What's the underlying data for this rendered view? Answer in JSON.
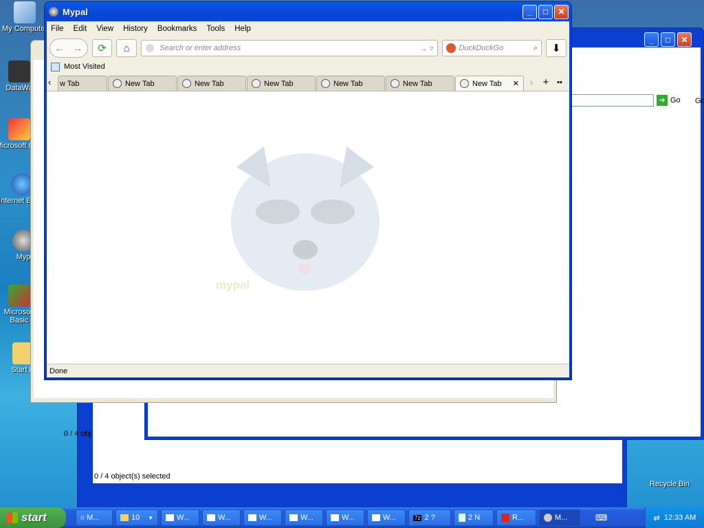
{
  "desktop": {
    "icons": [
      {
        "label": "My Computer"
      },
      {
        "label": "DataWa"
      },
      {
        "label": "Microsoft C++"
      },
      {
        "label": "Internet Explo"
      },
      {
        "label": "Myp"
      },
      {
        "label": "Microsoft Basic"
      },
      {
        "label": "Start M"
      },
      {
        "label": "Recycle Bin"
      }
    ]
  },
  "bg_windows": {
    "explorer_status_1": "0 / 4 obj",
    "explorer_status_2": "0 / 4 object(s) selected",
    "go_label": "Go",
    "go_label_2": "Go"
  },
  "window": {
    "title": "Mypal",
    "menu": [
      "File",
      "Edit",
      "View",
      "History",
      "Bookmarks",
      "Tools",
      "Help"
    ],
    "address_placeholder": "Search or enter address",
    "search_placeholder": "DuckDuckGo",
    "bookmarks_item": "Most Visited",
    "tabs": [
      {
        "label": "New Tab"
      },
      {
        "label": "New Tab"
      },
      {
        "label": "New Tab"
      },
      {
        "label": "New Tab"
      },
      {
        "label": "New Tab"
      },
      {
        "label": "New Tab"
      },
      {
        "label": "New Tab"
      }
    ],
    "first_tab_visible_text": "w Tab",
    "logo_text": "mypal",
    "status": "Done"
  },
  "taskbar": {
    "start_label": "start",
    "items": [
      {
        "label": "M..."
      },
      {
        "label": "10"
      },
      {
        "label": "W..."
      },
      {
        "label": "W..."
      },
      {
        "label": "W..."
      },
      {
        "label": "W..."
      },
      {
        "label": "W..."
      },
      {
        "label": "W..."
      },
      {
        "label": "2 ?"
      },
      {
        "label": "2 N"
      },
      {
        "label": "R..."
      },
      {
        "label": "M..."
      }
    ],
    "clock": "12:33 AM"
  },
  "colors": {
    "titlebar": "#0438c8",
    "chrome": "#f1efe2",
    "start_green": "#3a913a",
    "ddg_orange": "#de5833"
  }
}
